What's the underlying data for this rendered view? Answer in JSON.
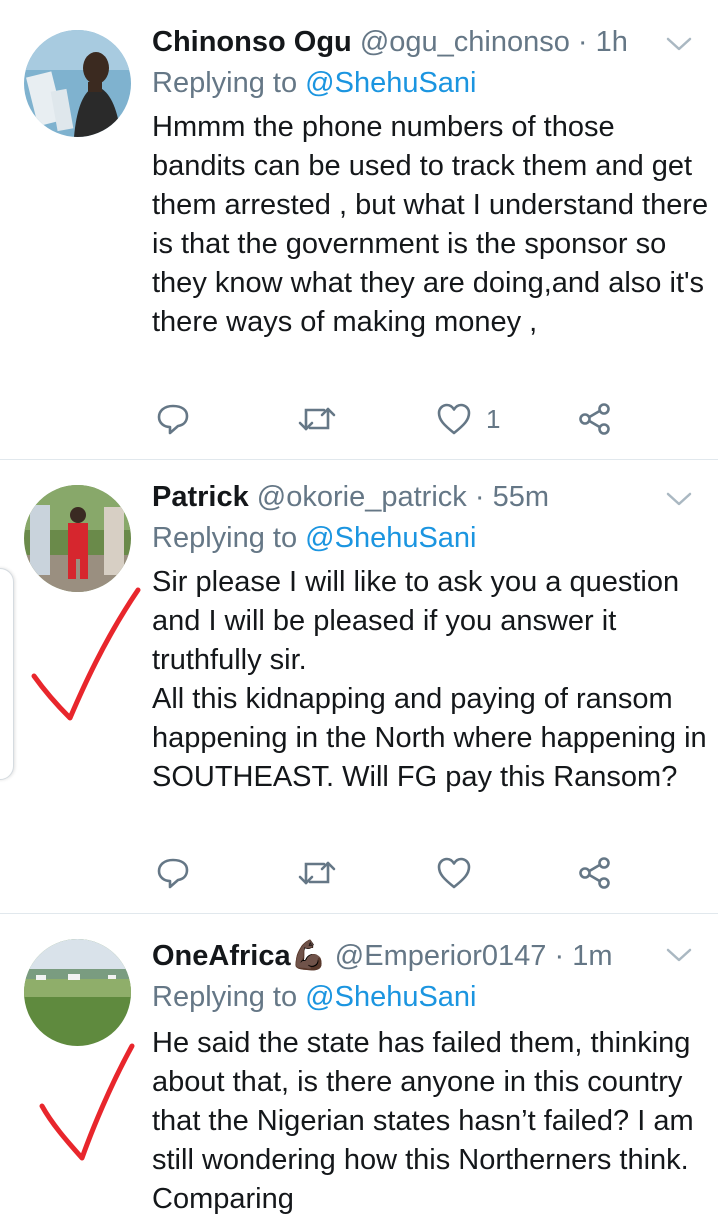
{
  "tweets": [
    {
      "name": "Chinonso Ogu",
      "handle": "@ogu_chinonso",
      "separator": "·",
      "time": "1h",
      "replying_prefix": "Replying to",
      "replying_mention": "@ShehuSani",
      "text": "Hmmm the phone numbers of those bandits can be used to track them and get them arrested , but what I understand there is that the government is the sponsor so they know what they are doing,and also it's there ways of making money ,",
      "like_count": "1"
    },
    {
      "name": "Patrick",
      "handle": "@okorie_patrick",
      "separator": "·",
      "time": "55m",
      "replying_prefix": "Replying to",
      "replying_mention": "@ShehuSani",
      "text": "Sir please I will like to ask you a question and I will be pleased if you answer it truthfully sir.\nAll this kidnapping and paying of ransom happening in the North where happening in SOUTHEAST. Will FG pay this Ransom?",
      "like_count": ""
    },
    {
      "name": "OneAfrica💪🏿",
      "handle": "@Emperior0147",
      "separator": "·",
      "time": "1m",
      "replying_prefix": "Replying to",
      "replying_mention": "@ShehuSani",
      "text": "He said the state has failed them, thinking about that, is there anyone in this country that the Nigerian states hasn’t failed? I am still wondering how this Northerners think. Comparing",
      "like_count": ""
    }
  ],
  "icons": {
    "reply": "reply-icon",
    "retweet": "retweet-icon",
    "like": "heart-icon",
    "share": "share-icon",
    "more": "chevron-down-icon",
    "annotation": "red-checkmark"
  },
  "colors": {
    "text": "#14171a",
    "secondary": "#657786",
    "link": "#1b95e0",
    "divider": "#e1e8ed",
    "check": "#e8262c"
  }
}
